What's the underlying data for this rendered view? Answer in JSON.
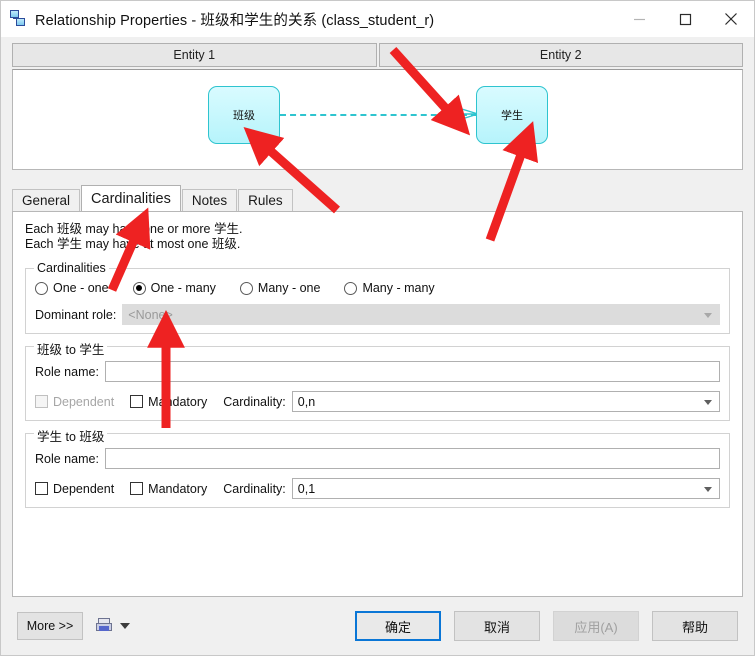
{
  "window": {
    "title": "Relationship Properties - 班级和学生的关系 (class_student_r)",
    "app_icon": "relationship-icon",
    "controls": {
      "minimize": "minimize-icon",
      "maximize": "maximize-icon",
      "close": "close-icon"
    }
  },
  "entity_headers": [
    {
      "label": "Entity 1"
    },
    {
      "label": "Entity 2"
    }
  ],
  "diagram": {
    "left_entity": "班级",
    "right_entity": "学生",
    "link_style": "dashed",
    "link_color": "#2ec4cf",
    "end_symbol": "crow-foot"
  },
  "tabs": [
    {
      "label": "General",
      "active": false
    },
    {
      "label": "Cardinalities",
      "active": true
    },
    {
      "label": "Notes",
      "active": false
    },
    {
      "label": "Rules",
      "active": false
    }
  ],
  "description": {
    "line1": "Each 班级 may have one or more 学生.",
    "line2": "Each 学生 may have at most one 班级."
  },
  "cardinalities_group": {
    "title": "Cardinalities",
    "options": [
      {
        "label": "One - one",
        "checked": false
      },
      {
        "label": "One - many",
        "checked": true
      },
      {
        "label": "Many - one",
        "checked": false
      },
      {
        "label": "Many - many",
        "checked": false
      }
    ],
    "dominant_role": {
      "label": "Dominant role:",
      "value": "<None>",
      "disabled": true
    }
  },
  "role_groups": [
    {
      "title": "班级 to 学生",
      "role_name_label": "Role name:",
      "role_name_value": "",
      "dependent": {
        "label": "Dependent",
        "checked": false,
        "disabled": true
      },
      "mandatory": {
        "label": "Mandatory",
        "checked": false,
        "disabled": false
      },
      "cardinality_label": "Cardinality:",
      "cardinality_value": "0,n"
    },
    {
      "title": "学生 to 班级",
      "role_name_label": "Role name:",
      "role_name_value": "",
      "dependent": {
        "label": "Dependent",
        "checked": false,
        "disabled": false
      },
      "mandatory": {
        "label": "Mandatory",
        "checked": false,
        "disabled": false
      },
      "cardinality_label": "Cardinality:",
      "cardinality_value": "0,1"
    }
  ],
  "footer": {
    "more_label": "More >>",
    "print_icon": "printer-icon",
    "print_caret": "caret-down-icon",
    "buttons": [
      {
        "label": "确定",
        "state": "default"
      },
      {
        "label": "取消",
        "state": "normal"
      },
      {
        "label": "应用(A)",
        "state": "disabled"
      },
      {
        "label": "帮助",
        "state": "normal"
      }
    ]
  },
  "annotations": {
    "color": "#ee2222",
    "arrows": [
      {
        "name": "arrow-to-crow-foot"
      },
      {
        "name": "arrow-to-left-entity"
      },
      {
        "name": "arrow-to-right-entity"
      },
      {
        "name": "arrow-to-cardinalities-tab"
      },
      {
        "name": "arrow-to-one-many-radio"
      }
    ]
  }
}
